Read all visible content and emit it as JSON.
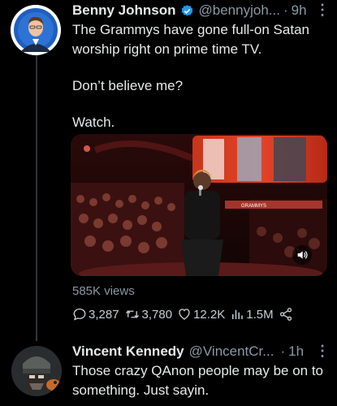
{
  "tweet": {
    "author_name": "Benny Johnson",
    "handle": "@bennyjoh...",
    "separator": "·",
    "time": "9h",
    "more": "⋮",
    "text_line1": "The Grammys have gone full-on Satan",
    "text_line2": "worship right on prime time TV.",
    "text_line3": "Don’t believe me?",
    "text_line4": "Watch.",
    "video": {
      "stage_sign": "GRAMMYS"
    },
    "views": "585K views",
    "stats": {
      "replies": "3,287",
      "retweets": "3,780",
      "likes": "12.2K",
      "views": "1.5M"
    }
  },
  "reply": {
    "author_name": "Vincent Kennedy",
    "handle": "@VincentCr...",
    "separator": "·",
    "time": "1h",
    "more": "⋮",
    "text_line1": "Those crazy QAnon people may be on to",
    "text_line2": "something. Just sayin."
  },
  "colors": {
    "background": "#000000",
    "text": "#e7e9ea",
    "muted": "#8b98a5",
    "verified": "#1d9bf0"
  },
  "icons": [
    "verified-badge-icon",
    "more-icon",
    "reply-icon",
    "retweet-icon",
    "like-icon",
    "views-icon",
    "share-icon",
    "volume-icon"
  ]
}
